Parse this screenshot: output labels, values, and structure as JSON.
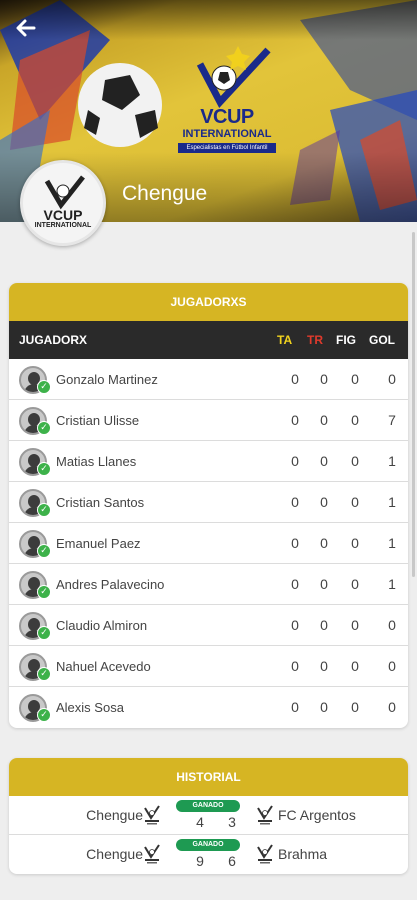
{
  "header": {
    "team_name": "Chengue",
    "brand_line1": "VCUP",
    "brand_line2": "INTERNATIONAL",
    "brand_tagline": "Especialistas en Fútbol Infantil",
    "back_icon": "arrow-left-icon"
  },
  "players_card": {
    "title": "JUGADORXS",
    "columns": {
      "player": "JUGADORX",
      "ta": "TA",
      "tr": "TR",
      "fig": "FIG",
      "gol": "GOL"
    },
    "rows": [
      {
        "name": "Gonzalo Martinez",
        "ta": "0",
        "tr": "0",
        "fig": "0",
        "gol": "0"
      },
      {
        "name": "Cristian Ulisse",
        "ta": "0",
        "tr": "0",
        "fig": "0",
        "gol": "7"
      },
      {
        "name": "Matias Llanes",
        "ta": "0",
        "tr": "0",
        "fig": "0",
        "gol": "1"
      },
      {
        "name": "Cristian Santos",
        "ta": "0",
        "tr": "0",
        "fig": "0",
        "gol": "1"
      },
      {
        "name": "Emanuel Paez",
        "ta": "0",
        "tr": "0",
        "fig": "0",
        "gol": "1"
      },
      {
        "name": "Andres Palavecino",
        "ta": "0",
        "tr": "0",
        "fig": "0",
        "gol": "1"
      },
      {
        "name": "Claudio Almiron",
        "ta": "0",
        "tr": "0",
        "fig": "0",
        "gol": "0"
      },
      {
        "name": "Nahuel Acevedo",
        "ta": "0",
        "tr": "0",
        "fig": "0",
        "gol": "0"
      },
      {
        "name": "Alexis Sosa",
        "ta": "0",
        "tr": "0",
        "fig": "0",
        "gol": "0"
      }
    ]
  },
  "history_card": {
    "title": "HISTORIAL",
    "matches": [
      {
        "home": "Chengue",
        "away": "FC Argentos",
        "status": "GANADO",
        "home_score": "4",
        "away_score": "3"
      },
      {
        "home": "Chengue",
        "away": "Brahma",
        "status": "GANADO",
        "home_score": "9",
        "away_score": "6"
      }
    ]
  },
  "colors": {
    "accent_gold": "#d6b523",
    "header_dark": "#2a2a2a",
    "ta_yellow": "#f0d21e",
    "tr_red": "#e03a2c",
    "won_green": "#1e9a52",
    "check_green": "#3db24a"
  }
}
